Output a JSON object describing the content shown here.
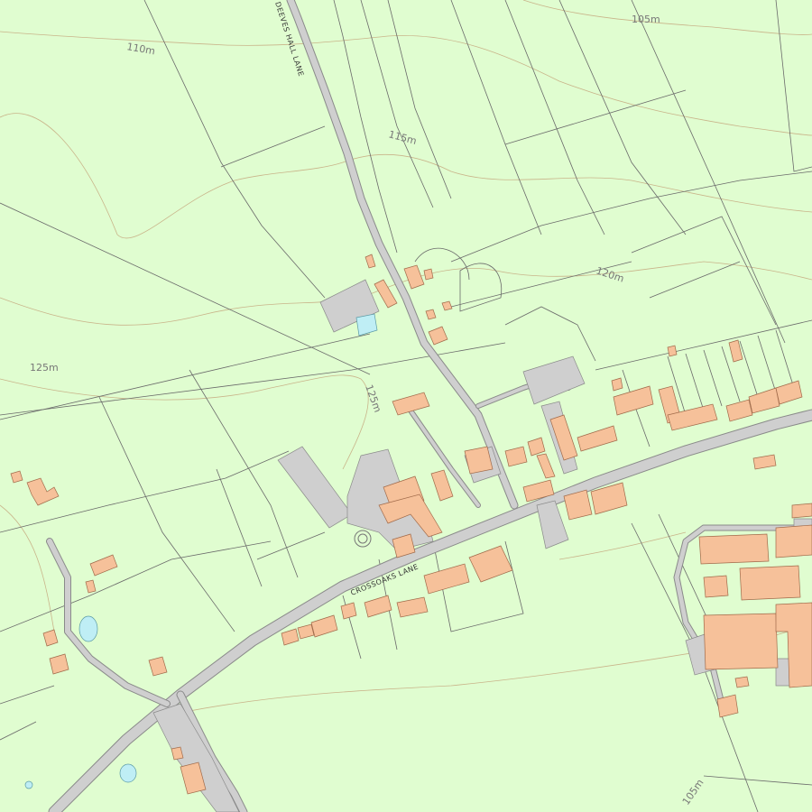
{
  "map": {
    "background_color": "#e0fdd0",
    "building_color": "#f6c19a",
    "road_color": "#cfcfcf",
    "water_color": "#bfeef5",
    "contour_color": "#c9b48a",
    "boundary_color": "#6a6a6a"
  },
  "road_labels": {
    "deeves_hall_lane": "DEEVES HALL LANE",
    "crossoaks_lane": "CROSSOAKS LANE"
  },
  "contour_labels": {
    "c105_top": "105m",
    "c110": "110m",
    "c115": "115m",
    "c120": "120m",
    "c125_left": "125m",
    "c125_mid": "125m",
    "c105_bottom": "105m"
  }
}
